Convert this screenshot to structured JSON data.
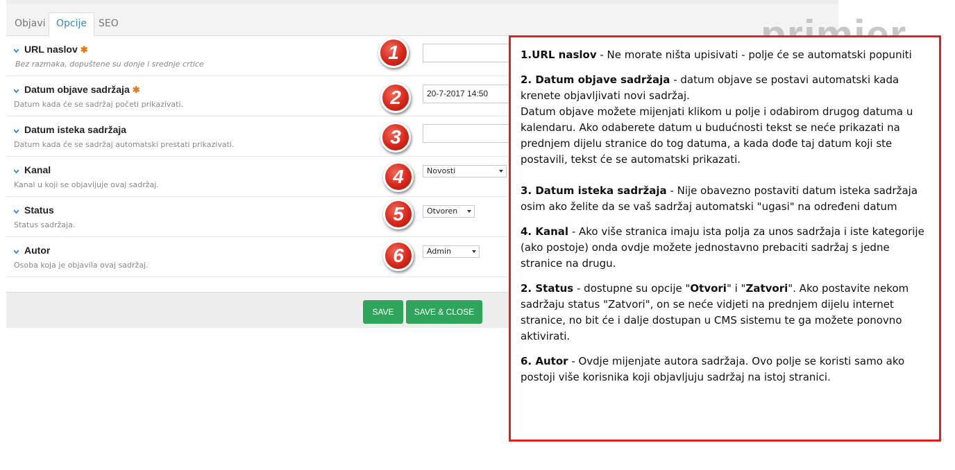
{
  "tabs": [
    "Objavi",
    "Opcije",
    "SEO"
  ],
  "active_tab": "Opcije",
  "fields": [
    {
      "label": "URL naslov",
      "required": true,
      "description": "Bez razmaka, dopuštene su donje i srednje crtice",
      "badge": "1",
      "control": "input",
      "value": ""
    },
    {
      "label": "Datum objave sadržaja",
      "required": true,
      "description": "Datum kada će se sadržaj početi prikazivati.",
      "badge": "2",
      "control": "input",
      "value": "20-7-2017 14:50"
    },
    {
      "label": "Datum isteka sadržaja",
      "required": false,
      "description": "Datum kada će se sadržaj automatski prestati prikazivati.",
      "badge": "3",
      "control": "input",
      "value": ""
    },
    {
      "label": "Kanal",
      "required": false,
      "description": "Kanal u koji se objavljuje ovaj sadržaj.",
      "badge": "4",
      "control": "select",
      "value": "Novosti"
    },
    {
      "label": "Status",
      "required": false,
      "description": "Status sadržaja.",
      "badge": "5",
      "control": "select",
      "value": "Otvoren"
    },
    {
      "label": "Autor",
      "required": false,
      "description": "Osoba koja je objavila ovaj sadržaj.",
      "badge": "6",
      "control": "select",
      "value": "Admin"
    }
  ],
  "required_mark": "✱",
  "buttons": {
    "save": "SAVE",
    "save_close": "SAVE & CLOSE"
  },
  "watermark": "primjer",
  "colors": {
    "accent_blue": "#3a86c8",
    "required_orange": "#e8761a",
    "badge_red": "#d8261a",
    "button_green": "#2ea55a",
    "note_border": "#e02020"
  },
  "notes": {
    "n1": {
      "title": "1.URL naslov",
      "text": " -  Ne morate ništa upisivati - polje će se automatski popuniti"
    },
    "n2": {
      "title": "2. Datum objave sadržaja",
      "text": " - datum objave se postavi automatski kada krenete objavljivati novi sadržaj.",
      "text2": "Datum objave možete mijenjati klikom u polje i odabirom drugog datuma u kalendaru. Ako odaberete datum u budućnosti tekst se neće prikazati na prednjem dijelu stranice do tog datuma, a kada dođe taj datum koji ste postavili, tekst će se automatski prikazati."
    },
    "n3": {
      "title": "3. Datum isteka sadržaja",
      "text": " - Nije obavezno postaviti datum isteka sadržaja osim ako želite da se vaš sadržaj automatski \"ugasi\" na određeni datum"
    },
    "n4": {
      "title": "4. Kanal",
      "text": " - Ako više stranica imaju ista polja za unos sadržaja i iste kategorije (ako postoje) onda ovdje možete jednostavno prebaciti sadržaj s jedne stranice na drugu."
    },
    "n5": {
      "title": "2. Status",
      "text_a": " - dostupne su opcije \"",
      "opt1": "Otvori",
      "text_b": "\" i \"",
      "opt2": "Zatvori",
      "text_c": "\". Ako postavite nekom sadržaju status \"Zatvori\", on se neće vidjeti na prednjem dijelu internet stranice, no bit će i dalje dostupan u CMS sistemu te ga možete ponovno aktivirati."
    },
    "n6": {
      "title": "6. Autor",
      "text": " - Ovdje mijenjate autora sadržaja. Ovo polje se koristi samo ako postoji više korisnika koji objavljuju sadržaj na istoj stranici."
    }
  }
}
